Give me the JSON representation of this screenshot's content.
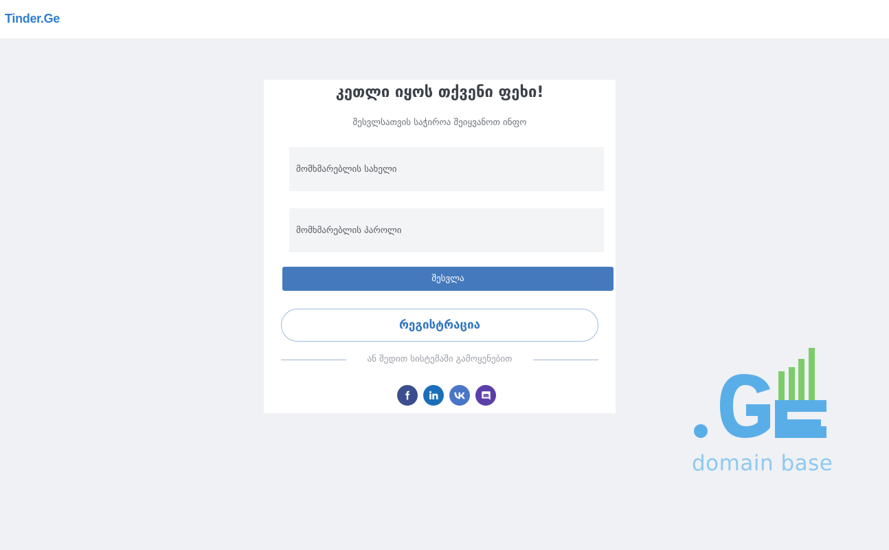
{
  "header": {
    "brand": "Tinder.Ge"
  },
  "login": {
    "title": "კეთლი იყოს თქვენი ფეხი!",
    "subtitle": "შესვლსათვის საჭიროა შეიყვანოთ ინფო",
    "username_placeholder": "მომხმარებლის სახელი",
    "password_placeholder": "მომხმარებლის პაროლი",
    "login_button": "შესვლა",
    "register_button": "რეგისტრაცია",
    "divider_text": "ან შედით სისტემაში გამოყენებით"
  },
  "social": {
    "icons": [
      "facebook-icon",
      "linkedin-icon",
      "vk-icon",
      "discord-icon"
    ]
  },
  "watermark": {
    "logo_text": "domain base",
    "logo_mark": ".GE"
  },
  "colors": {
    "background": "#eff1f5",
    "brand": "#2f7fd2",
    "login_button": "#4479bd",
    "register_border": "#9bbbe0",
    "logo_blue": "#5aaee8",
    "logo_green": "#7ccd6a"
  }
}
